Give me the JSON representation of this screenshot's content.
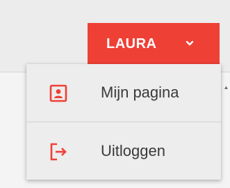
{
  "colors": {
    "accent": "#ef4036",
    "menu_bg": "#ededed",
    "text": "#3a3a3a"
  },
  "user_menu": {
    "user_name": "LAURA",
    "toggle_icon": "chevron-down-icon",
    "items": [
      {
        "label": "Mijn pagina",
        "icon": "profile-icon"
      },
      {
        "label": "Uitloggen",
        "icon": "logout-icon"
      }
    ]
  }
}
